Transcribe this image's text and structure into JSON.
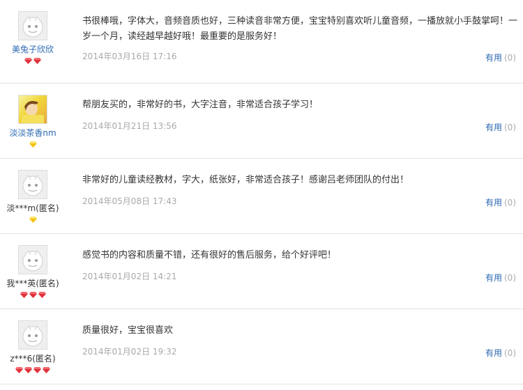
{
  "reviews": [
    {
      "user": "美兔子欣欣",
      "avatar": "default-avatar",
      "badge": "red-gem",
      "badge_count": 2,
      "text": "书很棒哦，字体大，音频音质也好，三种读音非常方便，宝宝特别喜欢听儿童音频，一播放就小手鼓掌呵！一岁一个月，读经越早越好哦！最重要的是服务好！",
      "date": "2014年03月16日 17:16",
      "useful_label": "有用",
      "useful_count": "(0)"
    },
    {
      "user": "淡淡茶香nm",
      "avatar": "photo-avatar",
      "badge": "yellow-gem",
      "badge_count": 1,
      "text": "帮朋友买的，非常好的书，大字注音，非常适合孩子学习！",
      "date": "2014年01月21日 13:56",
      "useful_label": "有用",
      "useful_count": "(0)"
    },
    {
      "user": "淡***m(匿名)",
      "avatar": "default-avatar",
      "badge": "yellow-gem",
      "badge_count": 1,
      "text": "非常好的儿童读经教材，字大，纸张好，非常适合孩子！感谢吕老师团队的付出！",
      "date": "2014年05月08日 17:43",
      "useful_label": "有用",
      "useful_count": "(0)"
    },
    {
      "user": "我***英(匿名)",
      "avatar": "default-avatar",
      "badge": "red-gem",
      "badge_count": 3,
      "text": "感觉书的内容和质量不错，还有很好的售后服务，给个好评吧！",
      "date": "2014年01月02日 14:21",
      "useful_label": "有用",
      "useful_count": "(0)"
    },
    {
      "user": "z***6(匿名)",
      "avatar": "default-avatar",
      "badge": "red-gem",
      "badge_count": 4,
      "text": "质量很好，宝宝很喜欢",
      "date": "2014年01月02日 19:32",
      "useful_label": "有用",
      "useful_count": "(0)"
    }
  ],
  "colors": {
    "link": "#2a67b1",
    "meta": "#a9a9a9",
    "text": "#333333",
    "divider": "#e2e2e2",
    "gem_red": "#e0303a",
    "gem_yellow": "#f3c214"
  }
}
